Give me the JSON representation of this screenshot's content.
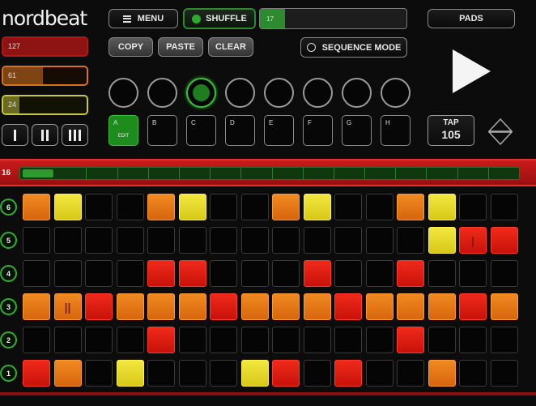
{
  "app": {
    "logo": "nordbeat"
  },
  "levels": [
    {
      "id": "red",
      "value": "127",
      "fill": 1.0
    },
    {
      "id": "orange",
      "value": "61",
      "fill": 0.48
    },
    {
      "id": "yellow",
      "value": "24",
      "fill": 0.19
    }
  ],
  "divisions": [
    "division-1-icon",
    "division-2-icon",
    "division-3-icon"
  ],
  "toolbar": {
    "menu_label": "MENU",
    "shuffle_label": "SHUFFLE",
    "shuffle_value": "17",
    "shuffle_fill": 0.17,
    "copy_label": "COPY",
    "paste_label": "PASTE",
    "clear_label": "CLEAR",
    "sequence_mode_label": "SEQUENCE MODE",
    "pads_label": "PADS"
  },
  "patterns": {
    "active_index": 2,
    "count": 8
  },
  "slots": [
    {
      "label": "A",
      "sub": "EDIT",
      "active": true
    },
    {
      "label": "B"
    },
    {
      "label": "C"
    },
    {
      "label": "D"
    },
    {
      "label": "E"
    },
    {
      "label": "F"
    },
    {
      "label": "G"
    },
    {
      "label": "H"
    }
  ],
  "tap": {
    "label": "TAP",
    "value": "105"
  },
  "steps": {
    "length_label": "16",
    "current_step": 1
  },
  "rows": [
    {
      "label": "6",
      "pads": [
        "O",
        "Y",
        "-",
        "-",
        "O",
        "Y",
        "-",
        "-",
        "O",
        "Y",
        "-",
        "-",
        "O",
        "Y",
        "-",
        "-"
      ],
      "marks": {}
    },
    {
      "label": "5",
      "pads": [
        "-",
        "-",
        "-",
        "-",
        "-",
        "-",
        "-",
        "-",
        "-",
        "-",
        "-",
        "-",
        "-",
        "Y",
        "R",
        "R"
      ],
      "marks": {
        "14": "|"
      }
    },
    {
      "label": "4",
      "pads": [
        "-",
        "-",
        "-",
        "-",
        "R",
        "R",
        "-",
        "-",
        "-",
        "R",
        "-",
        "-",
        "R",
        "-",
        "-",
        "-"
      ],
      "marks": {}
    },
    {
      "label": "3",
      "pads": [
        "O",
        "O",
        "R",
        "O",
        "O",
        "O",
        "R",
        "O",
        "O",
        "O",
        "R",
        "O",
        "O",
        "O",
        "R",
        "O"
      ],
      "marks": {
        "1": "||"
      }
    },
    {
      "label": "2",
      "pads": [
        "-",
        "-",
        "-",
        "-",
        "R",
        "-",
        "-",
        "-",
        "-",
        "-",
        "-",
        "-",
        "R",
        "-",
        "-",
        "-"
      ],
      "marks": {}
    },
    {
      "label": "1",
      "pads": [
        "R",
        "O",
        "-",
        "Y",
        "-",
        "-",
        "-",
        "Y",
        "R",
        "-",
        "R",
        "-",
        "-",
        "O",
        "-",
        "-"
      ],
      "marks": {}
    }
  ],
  "colors": {
    "accent_green": "#2e9a2e",
    "pad_orange": "#f08a20",
    "pad_yellow": "#f2e840",
    "pad_red": "#f02a1a",
    "step_bar_red": "#c81a1a"
  }
}
